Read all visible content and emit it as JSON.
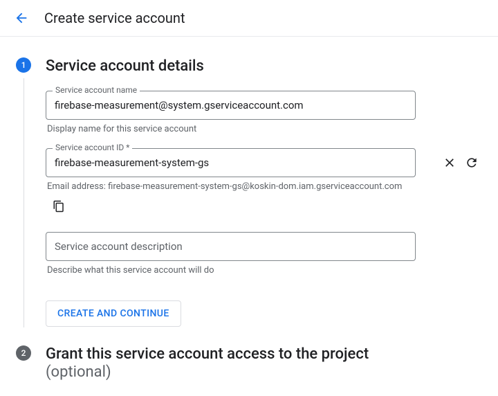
{
  "header": {
    "title": "Create service account"
  },
  "step1": {
    "number": "1",
    "title": "Service account details",
    "name_field": {
      "label": "Service account name",
      "value": "firebase-measurement@system.gserviceaccount.com",
      "helper": "Display name for this service account"
    },
    "id_field": {
      "label": "Service account ID *",
      "value": "firebase-measurement-system-gs",
      "email_prefix": "Email address: ",
      "email": "firebase-measurement-system-gs@koskin-dom.iam.gserviceaccount.com"
    },
    "desc_field": {
      "placeholder": "Service account description",
      "helper": "Describe what this service account will do"
    },
    "create_button": "CREATE AND CONTINUE"
  },
  "step2": {
    "number": "2",
    "title": "Grant this service account access to the project",
    "optional": "(optional)"
  }
}
